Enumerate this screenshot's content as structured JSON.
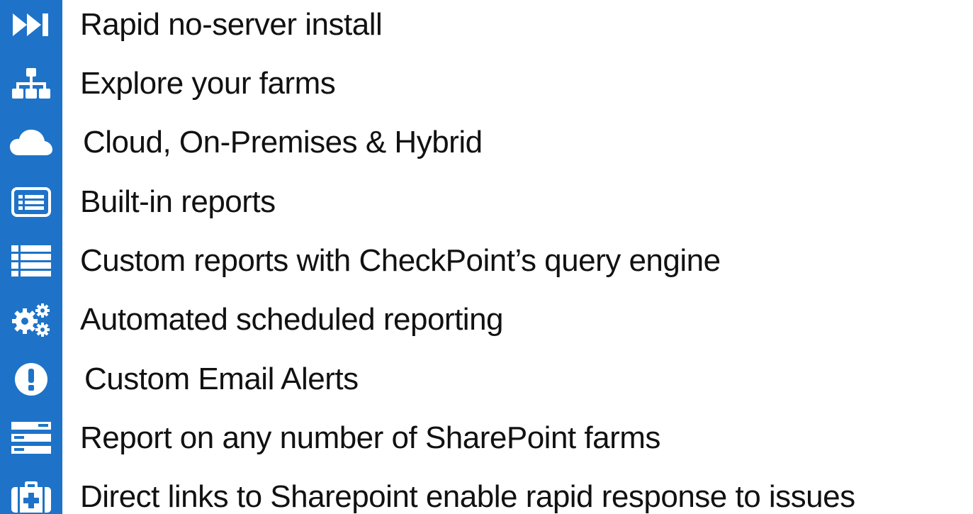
{
  "colors": {
    "icon_bar": "#1e73c8",
    "icon": "#ffffff",
    "text": "#111111",
    "background": "#ffffff"
  },
  "features": [
    {
      "icon": "fast-forward-icon",
      "label": "Rapid no-server install"
    },
    {
      "icon": "sitemap-icon",
      "label": "Explore your farms"
    },
    {
      "icon": "cloud-icon",
      "label": "Cloud, On-Premises & Hybrid"
    },
    {
      "icon": "report-window-icon",
      "label": "Built-in reports"
    },
    {
      "icon": "list-icon",
      "label": "Custom reports with CheckPoint’s query engine"
    },
    {
      "icon": "gears-icon",
      "label": "Automated scheduled reporting"
    },
    {
      "icon": "alert-circle-icon",
      "label": "Custom Email Alerts"
    },
    {
      "icon": "server-stack-icon",
      "label": "Report on any number of SharePoint farms"
    },
    {
      "icon": "medkit-icon",
      "label": "Direct links to Sharepoint enable rapid response to issues"
    }
  ]
}
